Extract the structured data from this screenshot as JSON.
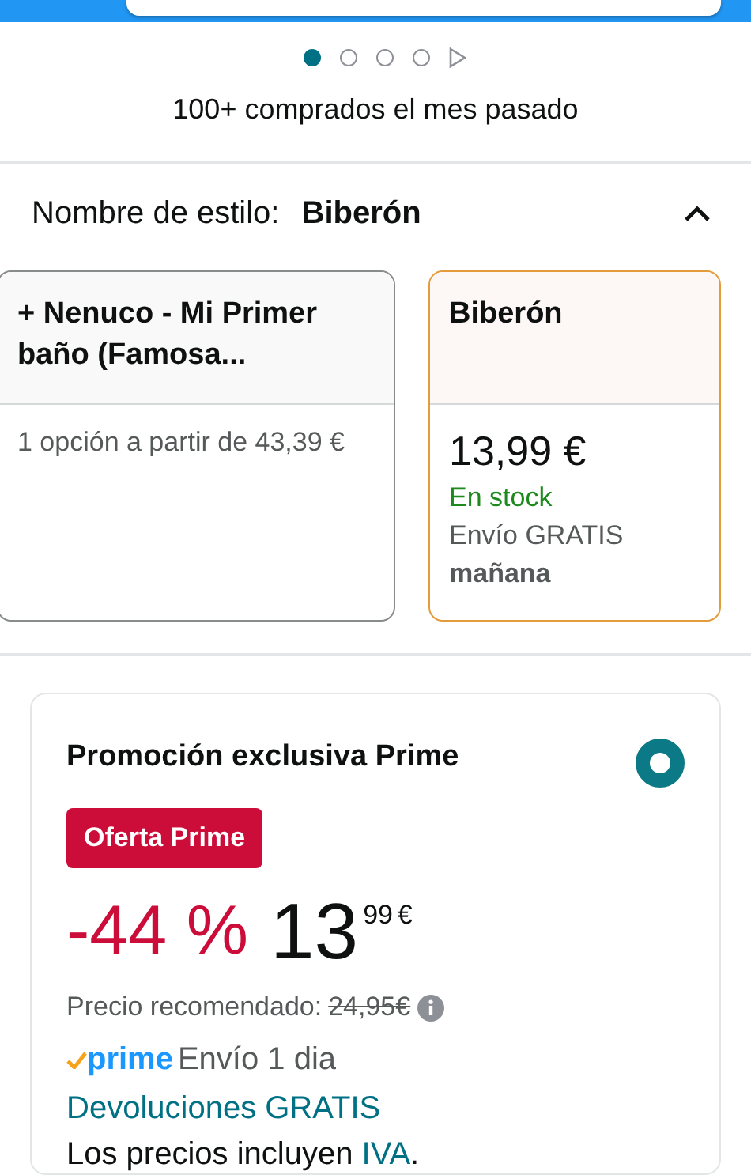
{
  "carousel": {
    "dots": [
      {
        "selected": true
      },
      {
        "selected": false
      },
      {
        "selected": false
      },
      {
        "selected": false
      }
    ]
  },
  "purchases_note": "100+ comprados el mes pasado",
  "style_selector": {
    "label": "Nombre de estilo:",
    "value": "Biberón",
    "expanded": true,
    "options": [
      {
        "title": "+ Nenuco - Mi Primer baño (Famosa...",
        "selected": false,
        "offers": "1 opción a partir de 43,39 €"
      },
      {
        "title": "Biberón",
        "selected": true,
        "price": "13,99 €",
        "availability": "En stock",
        "delivery": "Envío GRATIS",
        "delivery_date": "mañana"
      }
    ]
  },
  "promotion": {
    "title": "Promoción exclusiva Prime",
    "selected": true,
    "badge": "Oferta Prime",
    "discount": "-44 %",
    "price_whole": "13",
    "price_fraction": "99",
    "currency": "€",
    "list_price_label": "Precio recomendado:",
    "list_price": "24,95€",
    "prime_label": "prime",
    "prime_delivery": "Envío 1 dia",
    "returns": "Devoluciones GRATIS",
    "tax_prefix": "Los precios incluyen ",
    "tax_link": "IVA",
    "tax_suffix": "."
  }
}
